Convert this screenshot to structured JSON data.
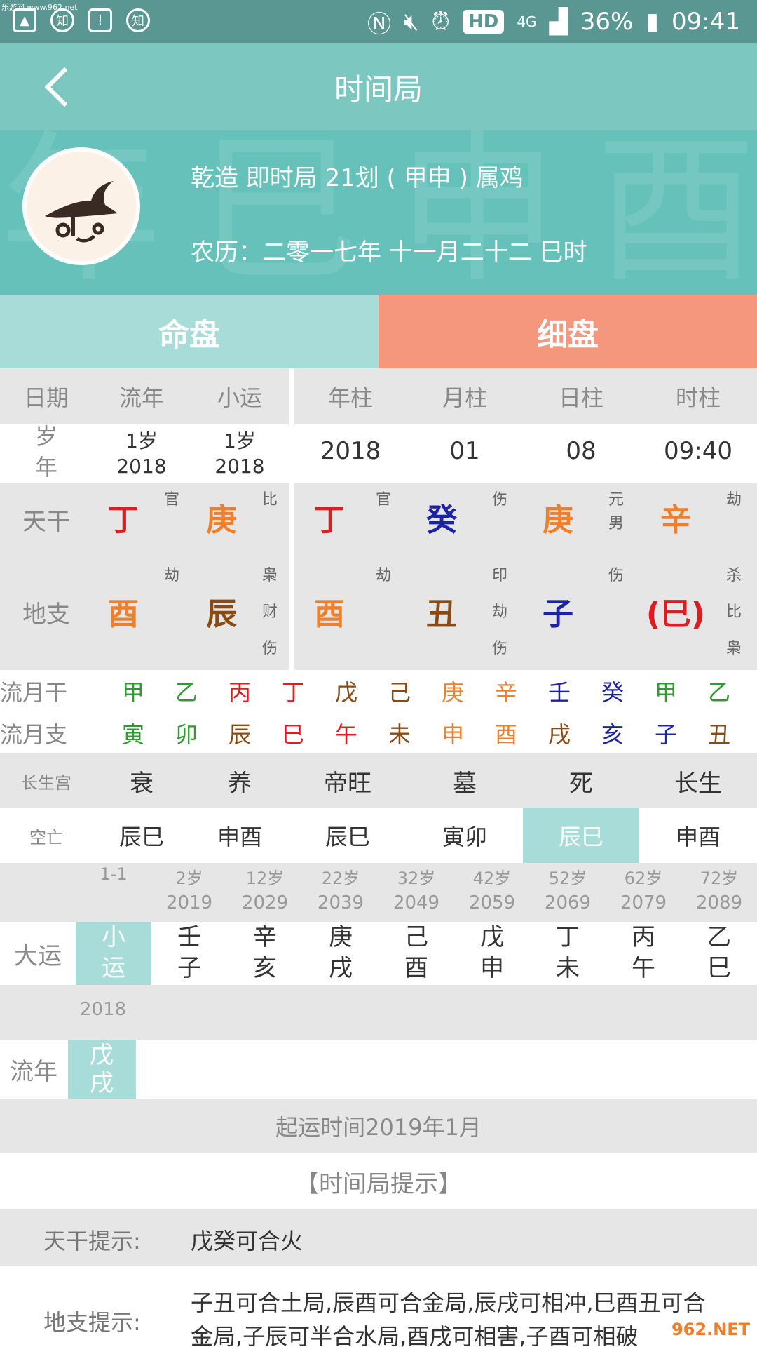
{
  "status_bar": {
    "watermark": "乐游网 www.962.net",
    "left_icons": [
      "image-icon",
      "zhi-app-icon",
      "sim-icon",
      "zhi-app-icon"
    ],
    "zhi1": "知",
    "zhi2": "知",
    "hd": "HD",
    "net": "4G",
    "battery": "36%",
    "time": "09:41"
  },
  "title_bar": {
    "title": "时间局"
  },
  "header": {
    "bg_chars": "年 巳 申 酉",
    "line1": "乾造  即时局  21划 ( 甲申 )  属鸡",
    "line2": "农历：二零一七年 十一月二十二 巳时"
  },
  "tabs": {
    "mingpan": "命盘",
    "xipan": "细盘"
  },
  "colhead": {
    "left": [
      "日期",
      "流年",
      "小运"
    ],
    "right": [
      "年柱",
      "月柱",
      "日柱",
      "时柱"
    ]
  },
  "date_row": {
    "label_top": "岁",
    "label_bottom": "年",
    "liunian_age": "1岁",
    "liunian_year": "2018",
    "xiaoyun_age": "1岁",
    "xiaoyun_year": "2018",
    "pillars": [
      "2018",
      "01",
      "08",
      "09:40"
    ]
  },
  "tiangan": {
    "label": "天干",
    "liunian": {
      "char": "丁",
      "note": "官"
    },
    "xiaoyun": {
      "char": "庚",
      "note": "比"
    },
    "year": {
      "char": "丁",
      "note": "官"
    },
    "month": {
      "char": "癸",
      "note": "伤"
    },
    "day": {
      "char": "庚",
      "note1": "元",
      "note2": "男"
    },
    "hour": {
      "char": "辛",
      "note": "劫"
    }
  },
  "dizhi": {
    "label": "地支",
    "liunian": {
      "char": "酉",
      "notes": [
        "劫"
      ]
    },
    "xiaoyun": {
      "char": "辰",
      "notes": [
        "枭",
        "财",
        "伤"
      ]
    },
    "year": {
      "char": "酉",
      "notes": [
        "劫"
      ]
    },
    "month": {
      "char": "丑",
      "notes": [
        "印",
        "劫",
        "伤"
      ]
    },
    "day": {
      "char": "子",
      "notes": [
        "伤"
      ]
    },
    "hour": {
      "char": "(巳)",
      "notes": [
        "杀",
        "比",
        "枭"
      ]
    }
  },
  "liuyue": {
    "gan_label": "流月干",
    "zhi_label": "流月支",
    "gan": [
      "甲",
      "乙",
      "丙",
      "丁",
      "戊",
      "己",
      "庚",
      "辛",
      "壬",
      "癸",
      "甲",
      "乙"
    ],
    "zhi": [
      "寅",
      "卯",
      "辰",
      "巳",
      "午",
      "未",
      "申",
      "酉",
      "戌",
      "亥",
      "子",
      "丑"
    ]
  },
  "changsheng": {
    "label": "长生宫",
    "values": [
      "衰",
      "养",
      "帝旺",
      "墓",
      "死",
      "长生"
    ]
  },
  "kongwang": {
    "label": "空亡",
    "values": [
      "辰巳",
      "申酉",
      "辰巳",
      "寅卯",
      "辰巳",
      "申酉"
    ]
  },
  "dayun": {
    "label": "大运",
    "ages": [
      "1-1",
      "2岁",
      "12岁",
      "22岁",
      "32岁",
      "42岁",
      "52岁",
      "62岁",
      "72岁"
    ],
    "years": [
      "",
      "2019",
      "2029",
      "2039",
      "2049",
      "2059",
      "2069",
      "2079",
      "2089"
    ],
    "gan": [
      "小",
      "壬",
      "辛",
      "庚",
      "己",
      "戊",
      "丁",
      "丙",
      "乙"
    ],
    "zhi": [
      "运",
      "子",
      "亥",
      "戌",
      "酉",
      "申",
      "未",
      "午",
      "巳"
    ]
  },
  "liunian": {
    "label": "流年",
    "year": "2018",
    "gan": "戊",
    "zhi": "戌"
  },
  "qiyun": "起运时间2019年1月",
  "tips_title": "【时间局提示】",
  "tips": {
    "tiangan_label": "天干提示:",
    "tiangan_text": "戊癸可合火",
    "dizhi_label": "地支提示:",
    "dizhi_line1": "子丑可合土局,辰酉可合金局,辰戌可相冲,巳酉丑可合",
    "dizhi_line2": "金局,子辰可半合水局,酉戌可相害,子酉可相破"
  },
  "corner_watermark": "962.NET"
}
